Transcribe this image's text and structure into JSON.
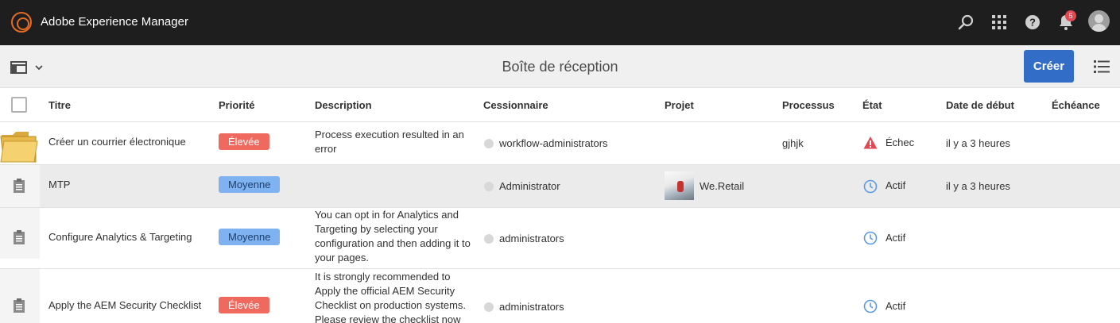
{
  "app": {
    "title": "Adobe Experience Manager"
  },
  "topbar": {
    "icons": [
      "search-icon",
      "apps-icon",
      "help-icon",
      "bell-icon"
    ],
    "notification_count": "5"
  },
  "actionbar": {
    "title": "Boîte de réception",
    "create_label": "Créer"
  },
  "table": {
    "columns": {
      "title": "Titre",
      "priority": "Priorité",
      "description": "Description",
      "assignee": "Cessionnaire",
      "project": "Projet",
      "workflow": "Processus",
      "state": "État",
      "start": "Date de début",
      "due": "Échéance"
    },
    "rows": [
      {
        "title": "Créer un courrier électronique",
        "priority": "Élevée",
        "description": "Process execution resulted in an error",
        "assignee": "workflow-administrators",
        "project": "",
        "workflow": "gjhjk",
        "state": "Échec",
        "start": "il y a 3 heures",
        "due": ""
      },
      {
        "title": "MTP",
        "priority": "Moyenne",
        "description": "",
        "assignee": "Administrator",
        "project": "We.Retail",
        "workflow": "",
        "state": "Actif",
        "start": "il y a 3 heures",
        "due": ""
      },
      {
        "title": "Configure Analytics & Targeting",
        "priority": "Moyenne",
        "description": "You can opt in for Analytics and Targeting by selecting your configuration and then adding it to your pages.",
        "assignee": "administrators",
        "project": "",
        "workflow": "",
        "state": "Actif",
        "start": "",
        "due": ""
      },
      {
        "title": "Apply the AEM Security Checklist",
        "priority": "Élevée",
        "description": "It is strongly recommended to Apply the official AEM Security Checklist on production systems. Please review the checklist now",
        "assignee": "administrators",
        "project": "",
        "workflow": "",
        "state": "Actif",
        "start": "",
        "due": ""
      }
    ]
  },
  "colors": {
    "topbar": "#1e1e1e",
    "accent": "#326ec8",
    "priority_high": "#f0695f",
    "priority_medium": "#7fb2f0",
    "logo": "#e56b23"
  }
}
